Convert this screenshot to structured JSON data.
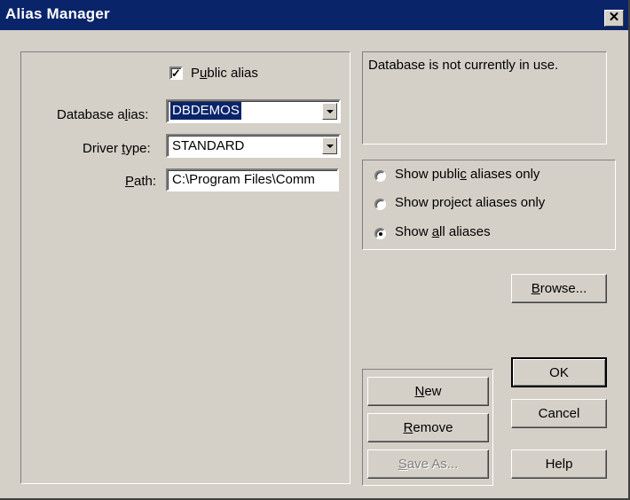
{
  "window": {
    "title": "Alias Manager",
    "close_glyph": "✕"
  },
  "left_panel": {
    "public_alias": {
      "label_pre": "P",
      "label_u": "u",
      "label_post": "blic alias",
      "checked": true
    },
    "database_alias": {
      "label_pre": "Database a",
      "label_u": "l",
      "label_post": "ias:",
      "value": "DBDEMOS"
    },
    "driver_type": {
      "label_pre": "Driver ",
      "label_u": "t",
      "label_post": "ype:",
      "value": "STANDARD"
    },
    "path": {
      "label_u": "P",
      "label_post": "ath:",
      "value": "C:\\Program Files\\Comm"
    }
  },
  "status": {
    "text": "Database is not currently in use."
  },
  "filter_options": [
    {
      "pre": "Show publi",
      "u": "c",
      "post": " aliases only",
      "selected": false
    },
    {
      "pre": "Show pro",
      "u": "j",
      "post": "ect aliases only",
      "selected": false
    },
    {
      "pre": "Show ",
      "u": "a",
      "post": "ll aliases",
      "selected": true
    }
  ],
  "buttons": {
    "browse": {
      "u": "B",
      "post": "rowse..."
    },
    "new": {
      "u": "N",
      "post": "ew"
    },
    "remove": {
      "u": "R",
      "post": "emove"
    },
    "save_as": {
      "u": "S",
      "post": "ave As...",
      "enabled": false
    },
    "ok": "OK",
    "cancel": "Cancel",
    "help": "Help"
  }
}
